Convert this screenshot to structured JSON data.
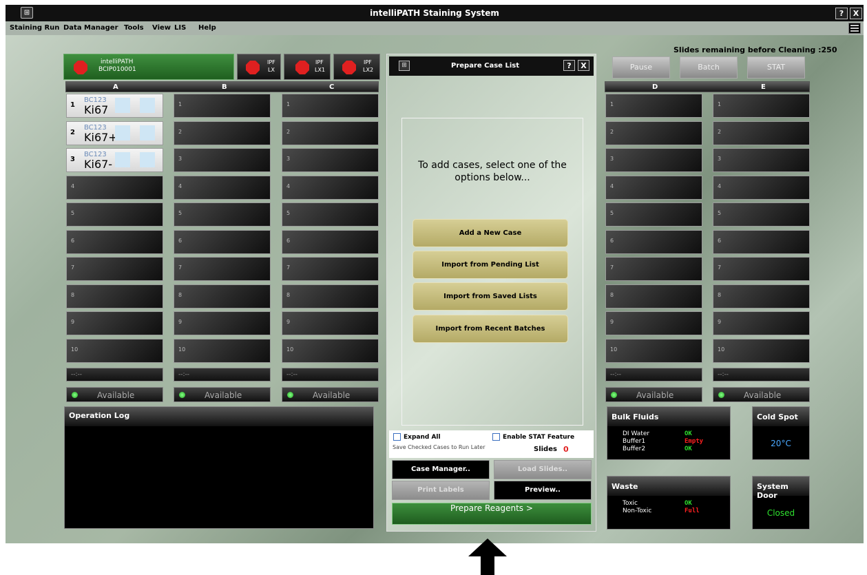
{
  "window": {
    "title": "intelliPATH Staining System",
    "help": "?",
    "close": "X",
    "logo": "⊞"
  },
  "menu": [
    "Staining Run",
    "Data Manager",
    "Tools",
    "View",
    "LIS",
    "Help"
  ],
  "instruments": {
    "main": {
      "name": "intelliPATH",
      "id": "BCIP010001"
    },
    "others": [
      {
        "line1": "IPF",
        "line2": "LX"
      },
      {
        "line1": "IPF",
        "line2": "LX1"
      },
      {
        "line1": "IPF",
        "line2": "LX2"
      }
    ]
  },
  "columns": {
    "A": "A",
    "B": "B",
    "C": "C",
    "D": "D",
    "E": "E"
  },
  "slot_numbers": [
    "1",
    "2",
    "3",
    "4",
    "5",
    "6",
    "7",
    "8",
    "9",
    "10"
  ],
  "filled_slots": [
    {
      "num": "1",
      "case": "BC123",
      "stain": "Ki67"
    },
    {
      "num": "2",
      "case": "BC123",
      "stain": "Ki67+"
    },
    {
      "num": "3",
      "case": "BC123",
      "stain": "Ki67-"
    }
  ],
  "time_placeholder": "--:--",
  "rack_status": "Available",
  "slides_remaining": "Slides remaining before Cleaning :250",
  "top_buttons": {
    "pause": "Pause",
    "batch": "Batch",
    "stat": "STAT"
  },
  "dialog": {
    "title": "Prepare Case List",
    "help": "?",
    "close": "X",
    "prompt": "To add cases, select one of the options below...",
    "options": [
      "Add a New Case",
      "Import from Pending List",
      "Import from Saved Lists",
      "Import from Recent Batches"
    ],
    "expand_all": "Expand All",
    "enable_stat": "Enable STAT Feature",
    "save_note": "Save Checked Cases to Run Later",
    "slides_label": "Slides",
    "slides_count": "0",
    "case_manager": "Case Manager..",
    "load_slides": "Load Slides..",
    "print_labels": "Print Labels",
    "preview": "Preview..",
    "prepare_reagents": "Prepare Reagents >"
  },
  "operation_log": {
    "title": "Operation Log"
  },
  "bulk_fluids": {
    "title": "Bulk Fluids",
    "items": [
      {
        "name": "DI Water",
        "status": "OK"
      },
      {
        "name": "Buffer1",
        "status": "Empty"
      },
      {
        "name": "Buffer2",
        "status": "OK"
      }
    ]
  },
  "cold_spot": {
    "title": "Cold Spot",
    "value": "20°C"
  },
  "waste": {
    "title": "Waste",
    "items": [
      {
        "name": "Toxic",
        "status": "OK"
      },
      {
        "name": "Non-Toxic",
        "status": "Full"
      }
    ]
  },
  "system_door": {
    "title": "System Door",
    "value": "Closed"
  },
  "colors": {
    "ok": "#2ee02e",
    "alert": "#ff2020",
    "cold": "#4aa8ff",
    "door": "#2ee02e"
  }
}
